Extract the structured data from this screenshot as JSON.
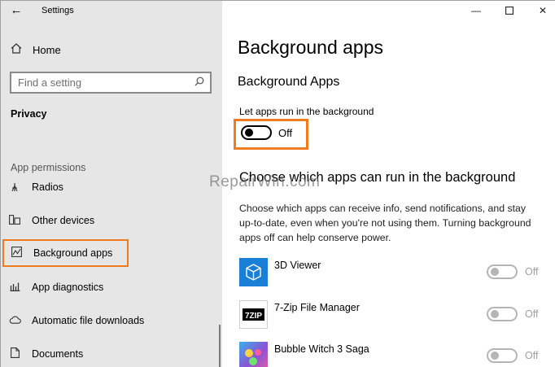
{
  "window": {
    "title": "Settings",
    "minimize_icon": "minimize-icon",
    "maximize_icon": "maximize-icon",
    "close_icon": "close-icon"
  },
  "nav": {
    "home_label": "Home",
    "search_placeholder": "Find a setting",
    "section": "Privacy",
    "group_header": "App permissions",
    "items": [
      {
        "label": "Radios",
        "icon": "radio-icon"
      },
      {
        "label": "Other devices",
        "icon": "devices-icon"
      },
      {
        "label": "Background apps",
        "icon": "background-apps-icon",
        "selected": true
      },
      {
        "label": "App diagnostics",
        "icon": "diagnostics-icon"
      },
      {
        "label": "Automatic file downloads",
        "icon": "cloud-icon"
      },
      {
        "label": "Documents",
        "icon": "document-icon"
      }
    ]
  },
  "main": {
    "title": "Background apps",
    "subtitle": "Background Apps",
    "setting_label": "Let apps run in the background",
    "toggle_state": "Off",
    "section_title": "Choose which apps can run in the background",
    "watermark": "RepairWin.com",
    "description": "Choose which apps can receive info, send notifications, and stay up-to-date, even when you're not using them. Turning background apps off can help conserve power.",
    "apps": [
      {
        "name": "3D Viewer",
        "state": "Off",
        "icon": "3d-viewer-icon"
      },
      {
        "name": "7-Zip File Manager",
        "state": "Off",
        "icon": "7zip-icon",
        "icon_text": "7ZIP"
      },
      {
        "name": "Bubble Witch 3 Saga",
        "state": "Off",
        "icon": "bubble-witch-icon"
      }
    ]
  },
  "colors": {
    "highlight": "#f07c22",
    "tile_blue": "#1a7fd6",
    "sidebar_bg": "#e6e6e6"
  }
}
